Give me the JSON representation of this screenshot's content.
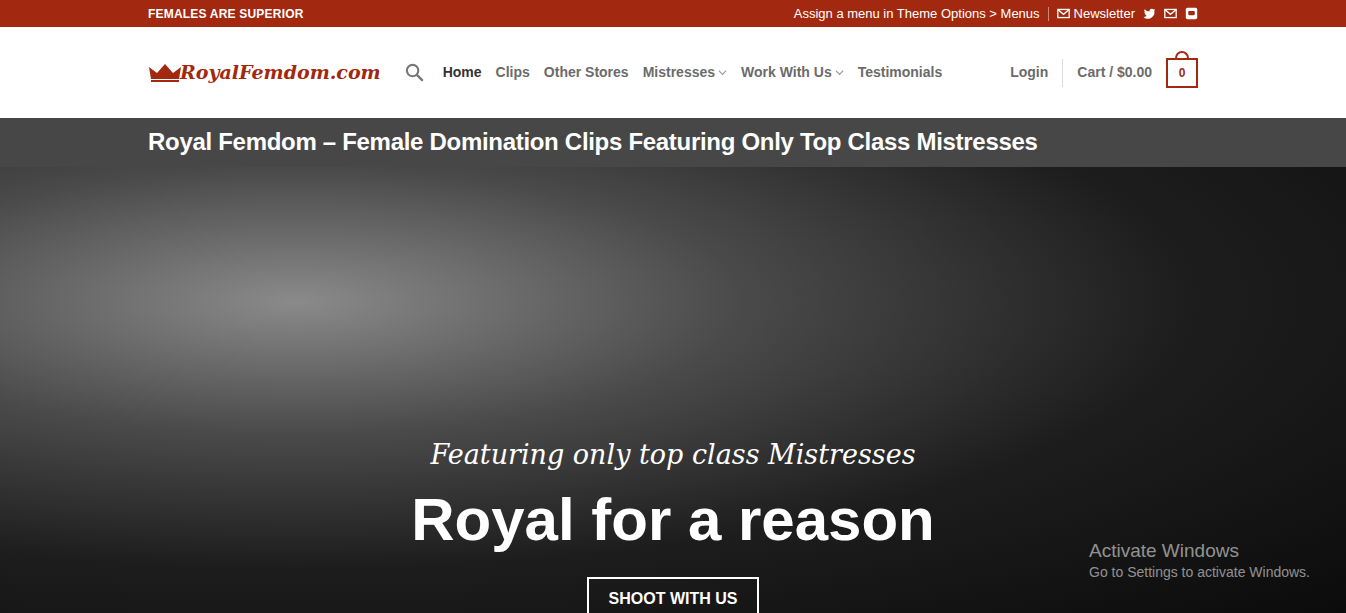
{
  "top_bar": {
    "tagline": "FEMALES ARE SUPERIOR",
    "menu_notice": "Assign a menu in Theme Options > Menus",
    "newsletter": "Newsletter"
  },
  "logo": {
    "text": "RoyalFemdom.com"
  },
  "nav": [
    {
      "label": "Home",
      "selected": true,
      "dropdown": false
    },
    {
      "label": "Clips",
      "selected": false,
      "dropdown": false
    },
    {
      "label": "Other Stores",
      "selected": false,
      "dropdown": false
    },
    {
      "label": "Mistresses",
      "selected": false,
      "dropdown": true
    },
    {
      "label": "Work With Us",
      "selected": false,
      "dropdown": true
    },
    {
      "label": "Testimonials",
      "selected": false,
      "dropdown": false
    }
  ],
  "account": {
    "login": "Login",
    "cart": "Cart / $0.00",
    "cart_count": "0"
  },
  "title_bar": {
    "title": "Royal Femdom – Female Domination Clips Featuring Only Top Class Mistresses"
  },
  "hero": {
    "kicker": "Featuring only top class Mistresses",
    "headline": "Royal for a reason",
    "button": "SHOOT WITH US"
  },
  "watermark": {
    "title": "Activate Windows",
    "subtitle": "Go to Settings to activate Windows."
  }
}
